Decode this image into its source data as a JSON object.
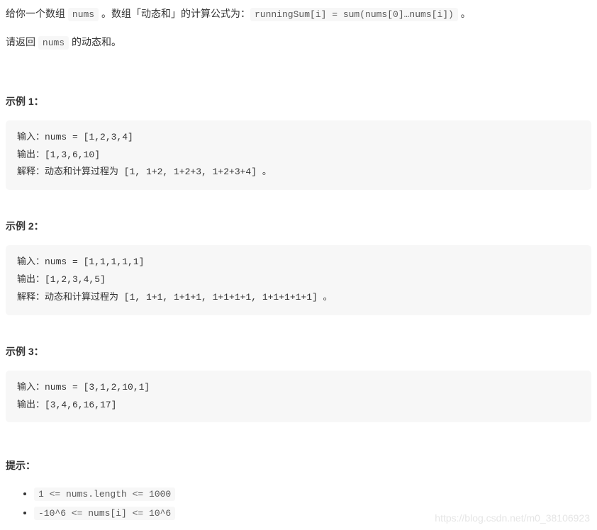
{
  "intro": {
    "prefix": "给你一个数组 ",
    "code1": "nums",
    "mid": " 。数组「动态和」的计算公式为：",
    "code2": "runningSum[i] = sum(nums[0]…nums[i])",
    "suffix": " 。"
  },
  "returnLine": {
    "prefix": "请返回 ",
    "code": "nums",
    "suffix": " 的动态和。"
  },
  "examples": [
    {
      "title": "示例 1：",
      "code": "输入：nums = [1,2,3,4]\n输出：[1,3,6,10]\n解释：动态和计算过程为 [1, 1+2, 1+2+3, 1+2+3+4] 。"
    },
    {
      "title": "示例 2：",
      "code": "输入：nums = [1,1,1,1,1]\n输出：[1,2,3,4,5]\n解释：动态和计算过程为 [1, 1+1, 1+1+1, 1+1+1+1, 1+1+1+1+1] 。"
    },
    {
      "title": "示例 3：",
      "code": "输入：nums = [3,1,2,10,1]\n输出：[3,4,6,16,17]"
    }
  ],
  "hints": {
    "title": "提示：",
    "items": [
      "1 <= nums.length <= 1000",
      "-10^6  <= nums[i] <=  10^6"
    ]
  },
  "watermark": "https://blog.csdn.net/m0_38106923"
}
